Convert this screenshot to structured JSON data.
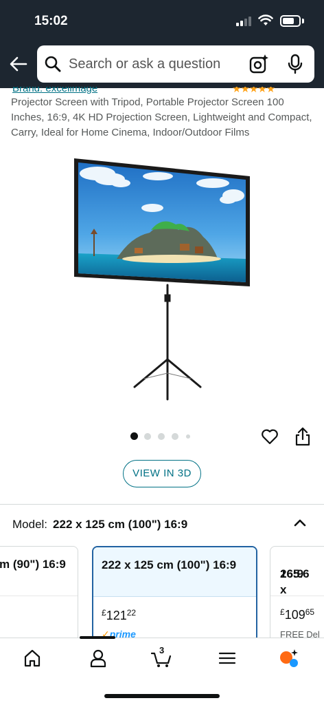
{
  "status_bar": {
    "time": "15:02"
  },
  "search": {
    "placeholder": "Search or ask a question"
  },
  "product": {
    "brand": "Brand: excelimage",
    "rating_stars": "★★★★★",
    "title": "Projector Screen with Tripod, Portable Projector Screen 100 Inches, 16:9, 4K HD Projection Screen, Lightweight and Compact, Carry, Ideal for Home Cinema, Indoor/Outdoor Films",
    "image_count": 5,
    "active_image": 1
  },
  "actions": {
    "view_3d": "VIEW IN 3D"
  },
  "model": {
    "label": "Model:",
    "selected": "222 x 125 cm (100\") 16:9"
  },
  "variants": [
    {
      "name": "m (90\") 16:9",
      "price": "",
      "note": ""
    },
    {
      "name": "222 x 125 cm (100\") 16:9",
      "currency": "£",
      "price_whole": "121",
      "price_fraction": "22",
      "prime": "prime",
      "selected": true
    },
    {
      "name_line1": "265.6 x",
      "name_line2": "16:9",
      "currency": "£",
      "price_whole": "109",
      "price_fraction": "65",
      "note": "FREE Del"
    }
  ],
  "bottom_nav": {
    "cart_count": "3"
  },
  "colors": {
    "header_bg": "#1d2630",
    "link": "#007185",
    "selected_border": "#2162a1",
    "prime": "#1a98ff",
    "alexa": "#ff6a13"
  }
}
